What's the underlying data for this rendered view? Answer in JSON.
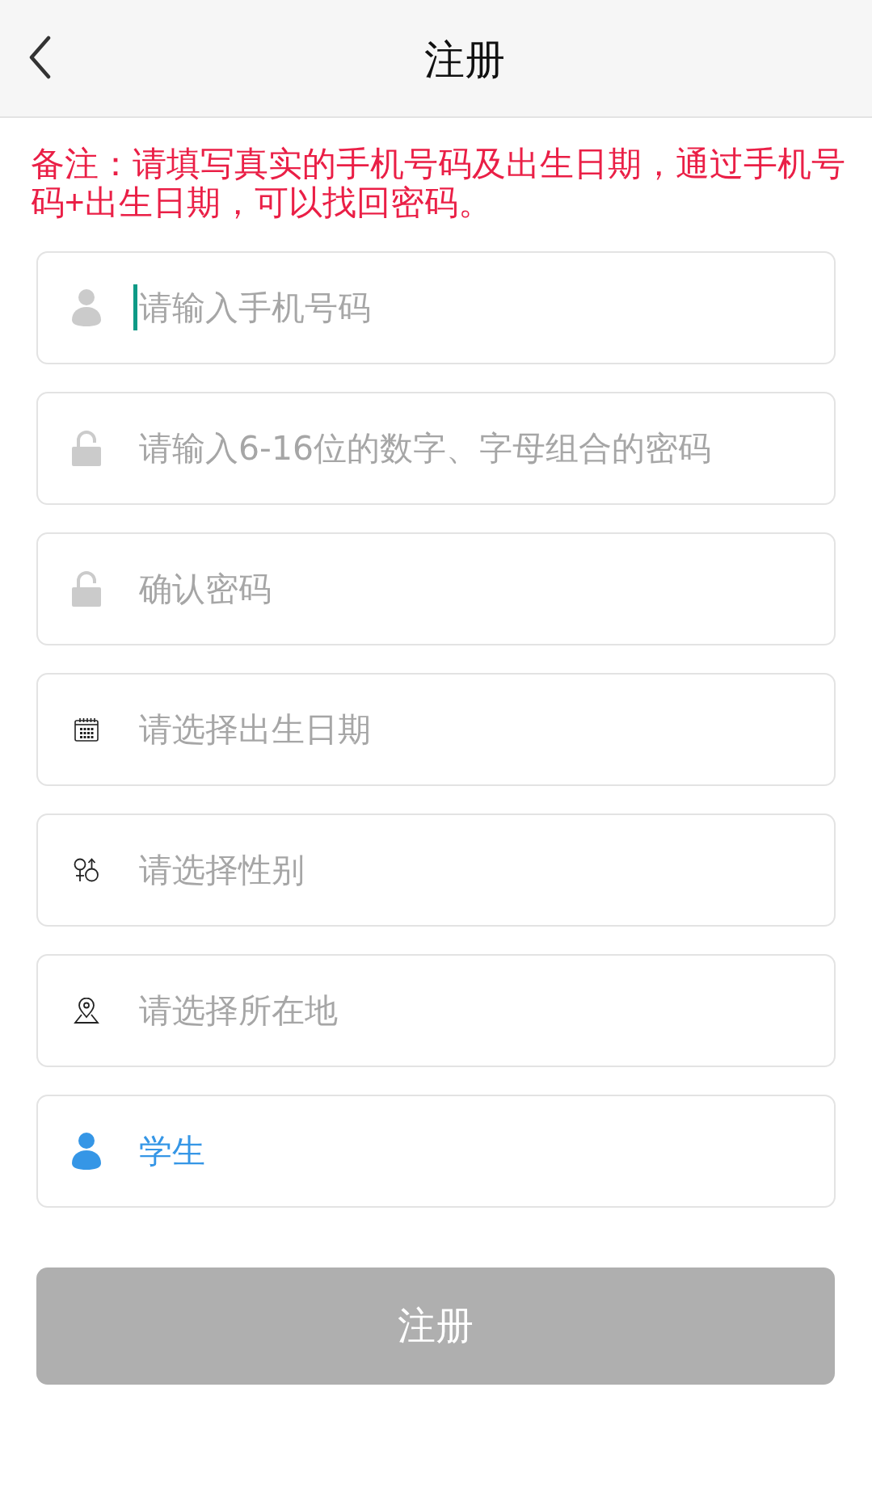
{
  "header": {
    "title": "注册"
  },
  "note": "备注：请填写真实的手机号码及出生日期，通过手机号码+出生日期，可以找回密码。",
  "fields": [
    {
      "kind": "phone",
      "placeholder": "请输入手机号码",
      "focused": true
    },
    {
      "kind": "password",
      "placeholder": "请输入6-16位的数字、字母组合的密码",
      "focused": false
    },
    {
      "kind": "confirm",
      "placeholder": "确认密码",
      "focused": false
    },
    {
      "kind": "date",
      "placeholder": "请选择出生日期",
      "focused": false
    },
    {
      "kind": "gender",
      "placeholder": "请选择性别",
      "focused": false
    },
    {
      "kind": "location",
      "placeholder": "请选择所在地",
      "focused": false
    },
    {
      "kind": "role",
      "value": "学生",
      "focused": false
    }
  ],
  "submit_button": {
    "label": "注册",
    "disabled": true
  }
}
